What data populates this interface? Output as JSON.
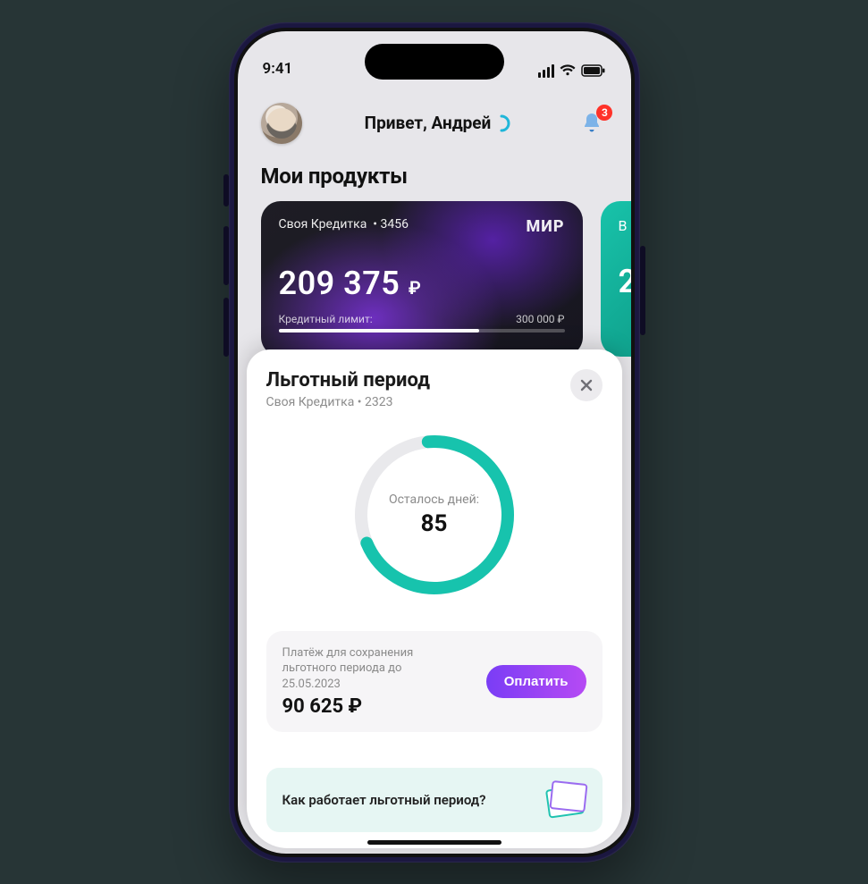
{
  "status": {
    "time": "9:41"
  },
  "header": {
    "greeting": "Привет, Андрей",
    "notification_count": "3"
  },
  "section_title": "Мои продукты",
  "card": {
    "name": "Своя Кредитка",
    "last4": "3456",
    "scheme": "МИР",
    "balance": "209 375",
    "currency": "₽",
    "limit_label": "Кредитный лимит:",
    "limit_value": "300 000 ₽",
    "limit_used_pct": 70
  },
  "card2": {
    "title_letter": "В",
    "big": "2"
  },
  "sheet": {
    "title": "Льготный период",
    "sub_card": "Своя Кредитка",
    "sub_last4": "2323",
    "ring": {
      "label": "Осталось дней:",
      "value": "85",
      "progress": 0.7
    },
    "payment": {
      "text_prefix": "Платёж для сохранения льготного периода до",
      "date": "25.05.2023",
      "amount": "90 625 ₽",
      "button": "Оплатить"
    },
    "info": "Как работает льготный период?"
  }
}
